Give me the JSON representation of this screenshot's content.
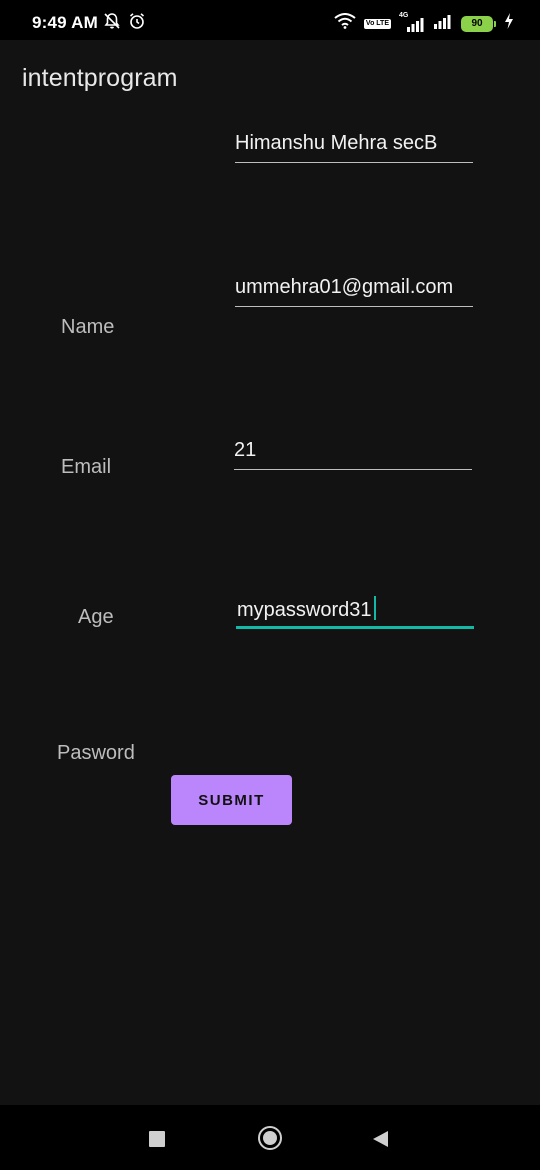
{
  "status_bar": {
    "time": "9:49 AM",
    "icons_left": [
      "notifications-off-icon",
      "alarm-icon"
    ],
    "icons_right": [
      "wifi-icon",
      "volte-icon",
      "4g-signal-icon",
      "signal-icon",
      "battery-icon",
      "charging-icon"
    ],
    "lte_badge": "Vo LTE",
    "network_label": "4G",
    "battery_level": "90"
  },
  "app": {
    "title": "intentprogram"
  },
  "form": {
    "labels": {
      "name": "Name",
      "email": "Email",
      "age": "Age",
      "password": "Pasword"
    },
    "fields": {
      "name_value": "Himanshu Mehra secB",
      "email_value": "ummehra01@gmail.com",
      "age_value": "21",
      "password_value": "mypassword31"
    },
    "submit_label": "SUBMIT"
  },
  "colors": {
    "background": "#121212",
    "accent_teal": "#14b8a6",
    "button_purple": "#bb86fc",
    "battery_green": "#8bd14a"
  },
  "nav_bar": {
    "icons": [
      "recents-icon",
      "home-icon",
      "back-icon"
    ]
  }
}
